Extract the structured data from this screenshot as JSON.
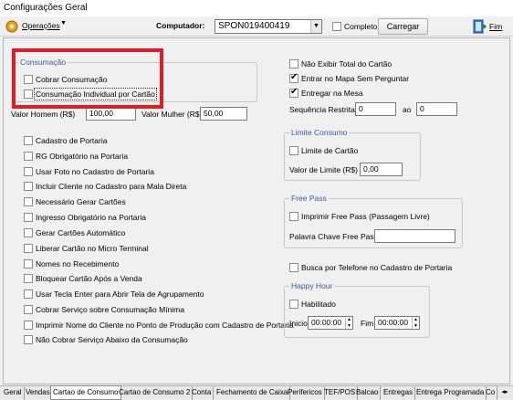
{
  "window": {
    "title": "Configurações Geral"
  },
  "toolbar": {
    "operacoes_label": "Operações",
    "computador_label": "Computador:",
    "computador_value": "SPON019400419",
    "completo_label": "Completo",
    "carregar_label": "Carregar",
    "fim_label": "Fim"
  },
  "consumacao": {
    "title": "Consumação",
    "cobrar_label": "Cobrar Consumação",
    "individual_label": "Consumação Individual por Cartão",
    "valor_homem_label": "Valor Homem (R$)",
    "valor_homem_value": "100,00",
    "valor_mulher_label": "Valor Mulher (R$)",
    "valor_mulher_value": "50,00"
  },
  "right_options": {
    "nao_exibir_label": "Não Exibir Total do Cartão",
    "entrar_mapa_label": "Entrar no Mapa Sem Perguntar",
    "entregar_mesa_label": "Entregar na Mesa",
    "sequencia_label": "Sequência Restrita:",
    "sequencia_from": "0",
    "ao_label": "ao",
    "sequencia_to": "0"
  },
  "left_options": [
    "Cadastro de Portaria",
    "RG Obrigatório na Portaria",
    "Usar Foto no Cadastro de Portaria",
    "Incluir Cliente no Cadastro para Mala Direta",
    "Necessário Gerar Cartões",
    "Ingresso Obrigatório na Portaria",
    "Gerar Cartões Automático",
    "Liberar Cartão no Micro Terminal",
    "Nomes no Recebimento",
    "Bloquear Cartão Após a Venda",
    "Usar Tecla Enter para Abrir Tela de Agrupamento",
    "Cobrar Serviço sobre Consumação Mínima",
    "Imprimir Nome do Cliente no Ponto de Produção com Cadastro de Portaria",
    "Não Cobrar Serviço Abaixo da Consumação"
  ],
  "limite": {
    "title": "Limite Consumo",
    "limite_cartao_label": "Limite de Cartão",
    "valor_limite_label": "Valor de Limite (R$)",
    "valor_limite_value": "0,00"
  },
  "free_pass": {
    "title": "Free Pass",
    "imprimir_label": "Imprimir Free Pass (Passagem Livre)",
    "palavra_label": "Palavra Chave Free Pass:",
    "palavra_value": ""
  },
  "busca_telefone_label": "Busca por Telefone no Cadastro de Portaria",
  "happy_hour": {
    "title": "Happy Hour",
    "habilitado_label": "Habilitado",
    "inicio_label": "Inicio",
    "inicio_value": "00:00:00",
    "fim_label": "Fim",
    "fim_value": "00:00:00"
  },
  "tabs": [
    "Geral",
    "Vendas",
    "Cartao de Consumo",
    "Cartao de Consumo 2",
    "Conta",
    "Fechamento de Caixa",
    "Perifericos",
    "TEF/POS",
    "Balcao",
    "Entregas",
    "Entrega Programada",
    "Co"
  ],
  "active_tab": "Cartao de Consumo",
  "colors": {
    "highlight": "#e11c24",
    "group_title": "#3c5a96"
  }
}
